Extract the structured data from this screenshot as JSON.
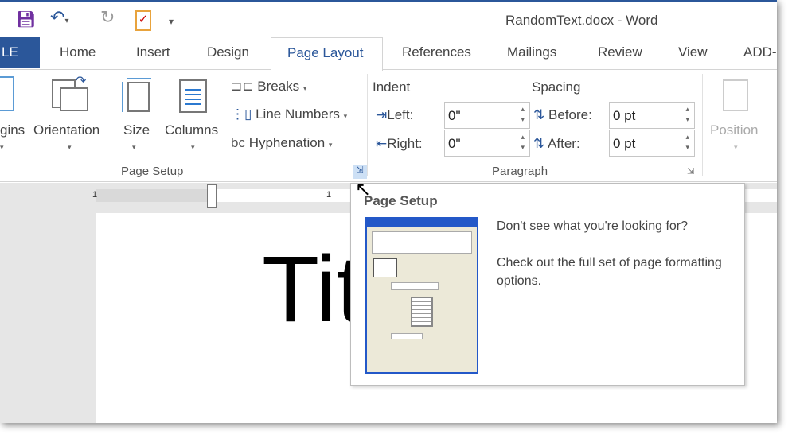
{
  "window": {
    "title": "RandomText.docx - Word"
  },
  "quick_access": {
    "icons": [
      "save-icon",
      "undo-icon",
      "redo-icon",
      "clipboard-check-icon",
      "customize-icon"
    ]
  },
  "tabs": {
    "file": "LE",
    "items": [
      "Home",
      "Insert",
      "Design",
      "Page Layout",
      "References",
      "Mailings",
      "Review",
      "View",
      "ADD-"
    ],
    "active": "Page Layout"
  },
  "page_setup": {
    "margins": "gins",
    "orientation": "Orientation",
    "size": "Size",
    "columns": "Columns",
    "breaks": "Breaks",
    "line_numbers": "Line Numbers",
    "hyphenation": "Hyphenation",
    "group_label": "Page Setup"
  },
  "paragraph": {
    "indent_label": "Indent",
    "spacing_label": "Spacing",
    "left_label": "Left:",
    "left_value": "0\"",
    "right_label": "Right:",
    "right_value": "0\"",
    "before_label": "Before:",
    "before_value": "0 pt",
    "after_label": "After:",
    "after_value": "0 pt",
    "group_label": "Paragraph"
  },
  "arrange": {
    "position": "Position"
  },
  "ruler": {
    "mark1": "1",
    "mark2": "1"
  },
  "document": {
    "text": "Title p"
  },
  "tooltip": {
    "title": "Page Setup",
    "line1": "Don't see what you're looking for?",
    "line2": "Check out the full set of page formatting options."
  },
  "colors": {
    "accent": "#2b579a",
    "tooltip_title": "#555555"
  }
}
